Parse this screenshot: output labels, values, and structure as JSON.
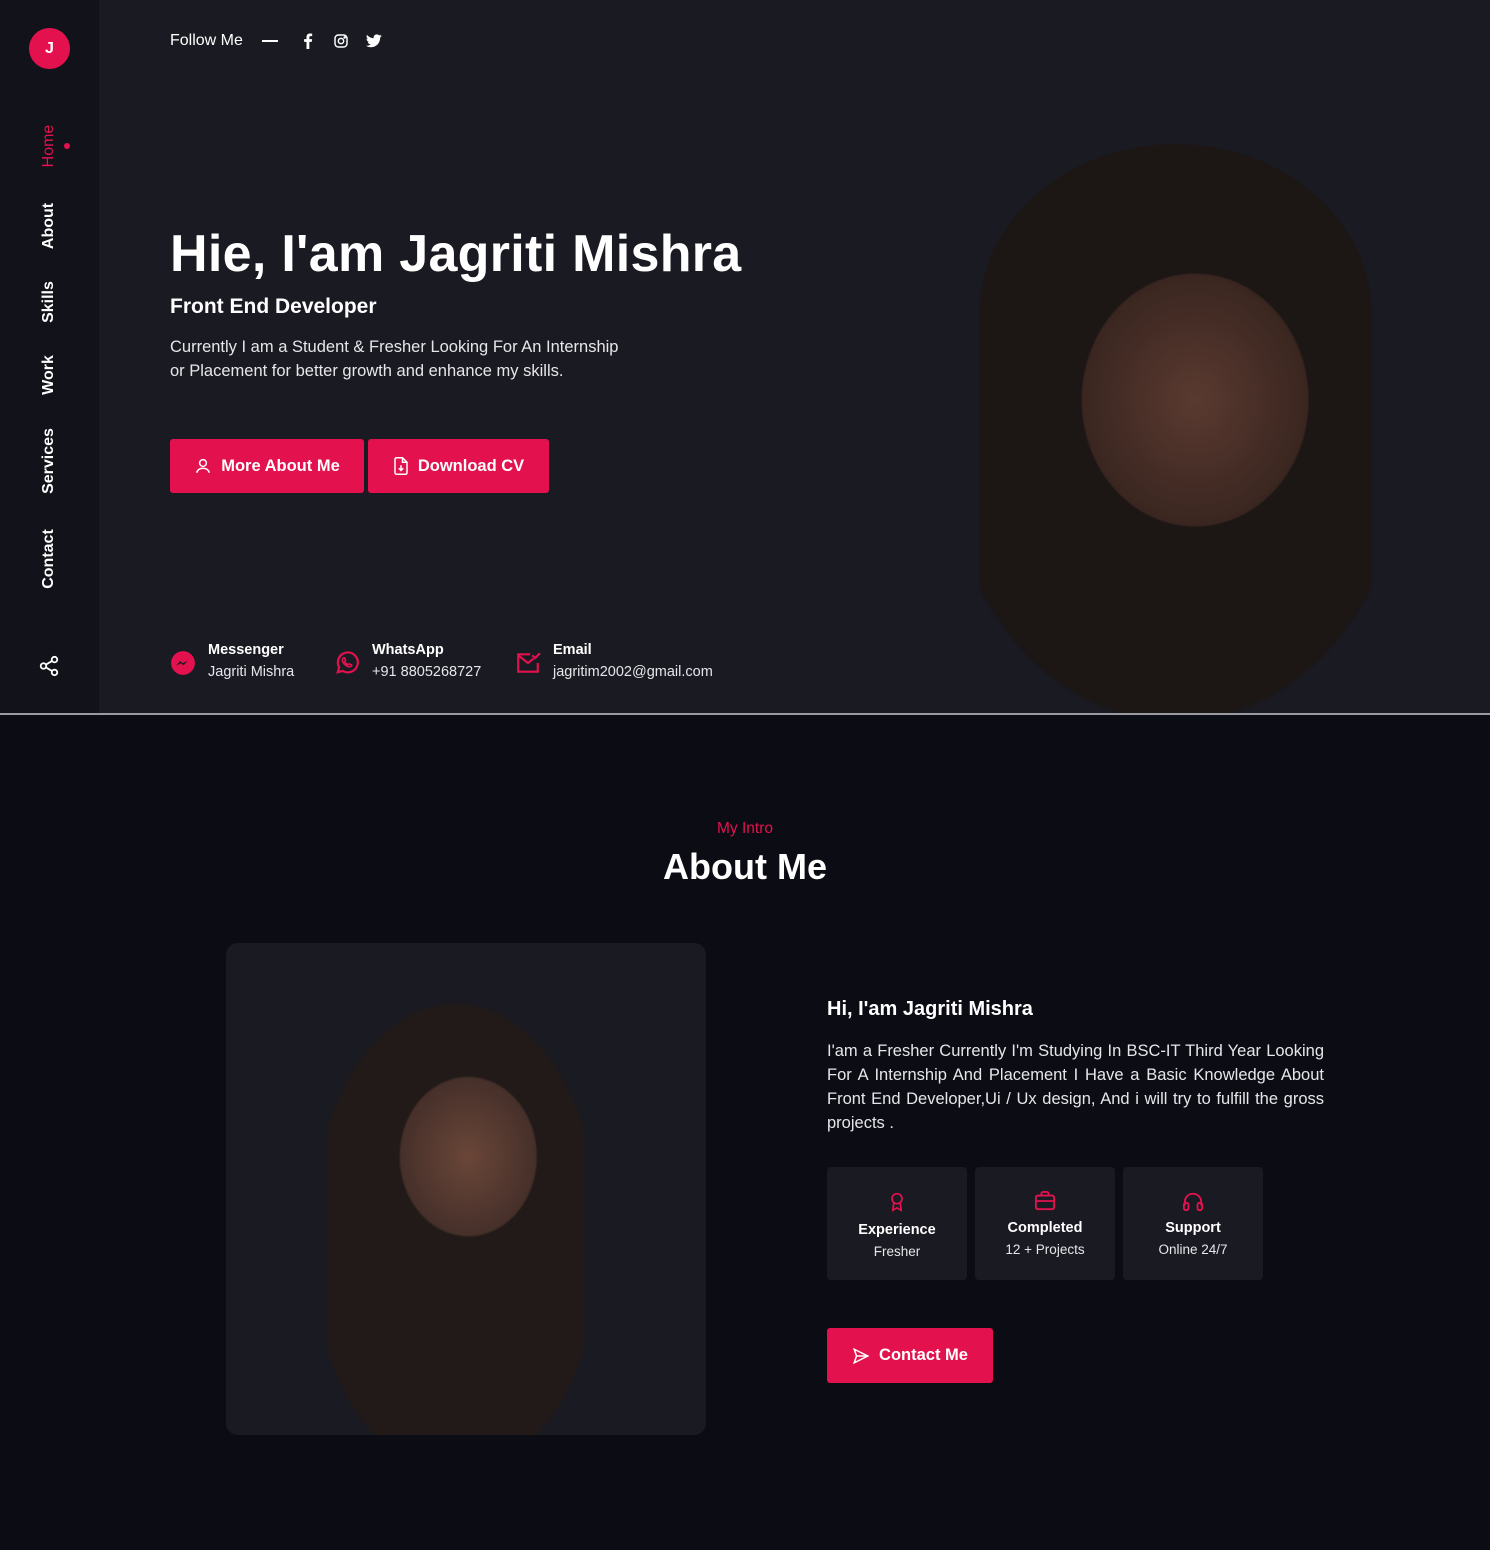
{
  "brand": {
    "logo_letter": "J",
    "accent": "#e3124e"
  },
  "sidebar": {
    "items": [
      {
        "label": "Home",
        "active": true
      },
      {
        "label": "About"
      },
      {
        "label": "Skills"
      },
      {
        "label": "Work"
      },
      {
        "label": "Services"
      },
      {
        "label": "Contact"
      }
    ],
    "share_icon": "share-icon"
  },
  "hero": {
    "follow_label": "Follow Me",
    "socials": [
      "facebook-icon",
      "instagram-icon",
      "twitter-icon"
    ],
    "title": "Hie, I'am Jagriti Mishra",
    "subtitle": "Front End Developer",
    "description": "Currently I am a Student & Fresher Looking For An Internship or Placement for better growth and enhance my skills.",
    "buttons": {
      "more": "More About Me",
      "cv": "Download CV"
    },
    "contacts": [
      {
        "label": "Messenger",
        "value": "Jagriti Mishra",
        "icon": "messenger-icon"
      },
      {
        "label": "WhatsApp",
        "value": "+91 8805268727",
        "icon": "whatsapp-icon"
      },
      {
        "label": "Email",
        "value": "jagritim2002@gmail.com",
        "icon": "email-icon"
      }
    ]
  },
  "about": {
    "eyebrow": "My Intro",
    "title": "About Me",
    "name": "Hi, I'am Jagriti Mishra",
    "text": "I'am a Fresher Currently I'm Studying In BSC-IT Third Year Looking For A Internship And Placement I Have a Basic Knowledge About Front End Developer,Ui / Ux design, And i will try to fulfill the gross projects .",
    "stats": [
      {
        "title": "Experience",
        "sub": "Fresher",
        "icon": "award-icon"
      },
      {
        "title": "Completed",
        "sub": "12 + Projects",
        "icon": "briefcase-icon"
      },
      {
        "title": "Support",
        "sub": "Online 24/7",
        "icon": "headphones-icon"
      }
    ],
    "contact_button": "Contact Me"
  }
}
